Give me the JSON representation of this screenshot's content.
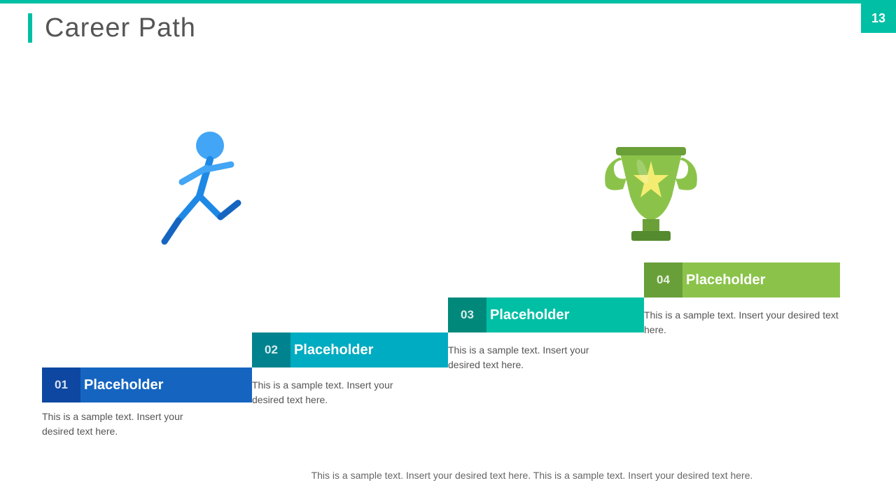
{
  "header": {
    "title": "Career Path",
    "slide_number": "13",
    "accent_color": "#00BFA5"
  },
  "steps": [
    {
      "number": "01",
      "label": "Placeholder",
      "color": "#1A6EC0",
      "number_bg": "#0D47A1",
      "description": "This is a sample text. Insert your desired text here."
    },
    {
      "number": "02",
      "label": "Placeholder",
      "color": "#00ACC1",
      "number_bg": "#00838F",
      "description": "This is a sample text. Insert your desired text here."
    },
    {
      "number": "03",
      "label": "Placeholder",
      "color": "#00BFA5",
      "number_bg": "#00897B",
      "description": "This is a sample text. Insert your desired text here."
    },
    {
      "number": "04",
      "label": "Placeholder",
      "color": "#8BC34A",
      "number_bg": "#6B9F38",
      "description": "This is a sample text. Insert your desired text here."
    }
  ],
  "bottom_text": "This is a sample text. Insert your desired text here. This is a sample text. Insert your desired text here.",
  "colors": {
    "accent": "#00BFA5",
    "slide_number_bg": "#00BFA5",
    "text": "#555555"
  }
}
